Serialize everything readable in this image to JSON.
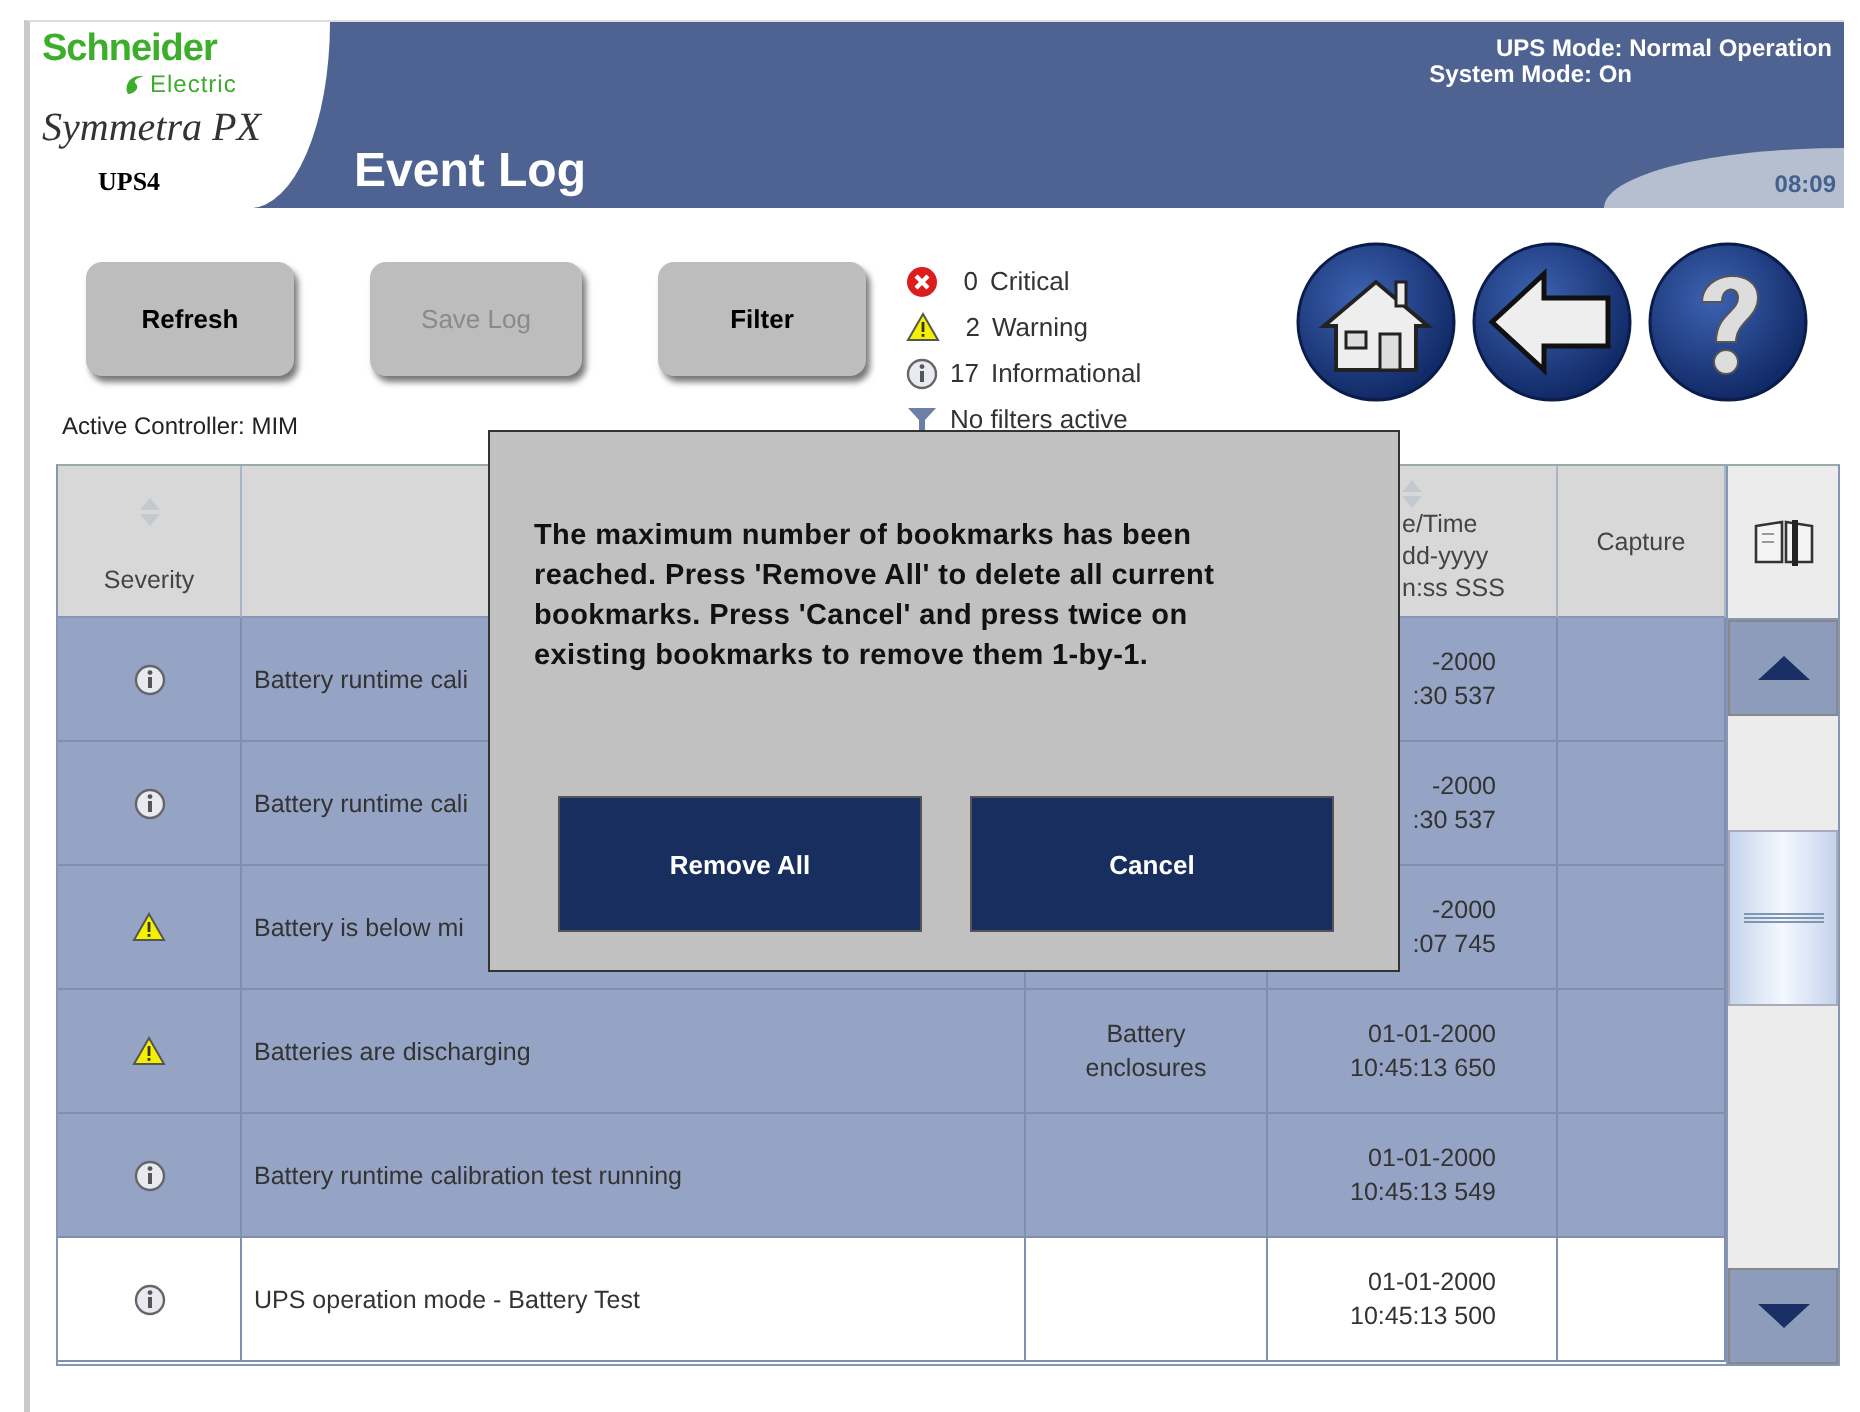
{
  "logo": {
    "brand": "Schneider",
    "sub": "Electric",
    "product": "Symmetra PX",
    "unit": "UPS4"
  },
  "header": {
    "title": "Event Log",
    "ups_mode": "UPS Mode: Normal Operation",
    "system_mode": "System Mode: On",
    "time": "08:09"
  },
  "toolbar": {
    "buttons": [
      {
        "label": "Refresh",
        "disabled": false
      },
      {
        "label": "Save Log",
        "disabled": true
      },
      {
        "label": "Filter",
        "disabled": false
      }
    ],
    "active_controller": "Active Controller: MIM"
  },
  "summary": [
    {
      "kind": "critical",
      "count": "0",
      "label": "Critical"
    },
    {
      "kind": "warning",
      "count": "2",
      "label": "Warning"
    },
    {
      "kind": "info",
      "count": "17",
      "label": "Informational"
    },
    {
      "kind": "filter",
      "label": "No filters active"
    }
  ],
  "nav": [
    {
      "kind": "home"
    },
    {
      "kind": "back"
    },
    {
      "kind": "help"
    }
  ],
  "table": {
    "columns": [
      {
        "label": "Severity",
        "sortable": true
      },
      {},
      {},
      {
        "lines": [
          "e/Time",
          "dd-yyyy",
          "n:ss SSS"
        ],
        "sortable": true
      },
      {
        "label": "Capture"
      }
    ],
    "rows": [
      {
        "kind": "info",
        "message": "Battery runtime cali",
        "date": "-2000",
        "time": ":30 537",
        "selected": true
      },
      {
        "kind": "info",
        "message": "Battery runtime cali",
        "date": "-2000",
        "time": ":30 537",
        "selected": true
      },
      {
        "kind": "warning",
        "message": "Battery is below mi",
        "date": "-2000",
        "time": ":07 745",
        "selected": true
      },
      {
        "kind": "warning",
        "message": "Batteries are discharging",
        "source": [
          "Battery",
          "enclosures"
        ],
        "date": "01-01-2000",
        "time": "10:45:13 650",
        "selected": true
      },
      {
        "kind": "info",
        "message": "Battery runtime calibration test running",
        "date": "01-01-2000",
        "time": "10:45:13 549",
        "selected": true
      },
      {
        "kind": "info",
        "message": "UPS operation mode - Battery Test",
        "date": "01-01-2000",
        "time": "10:45:13 500",
        "selected": false
      }
    ]
  },
  "dialog": {
    "message": "The maximum number of bookmarks has been reached. Press 'Remove All' to delete all current bookmarks. Press 'Cancel' and press twice on existing bookmarks to remove them 1-by-1.",
    "buttons": [
      "Remove All",
      "Cancel"
    ]
  }
}
